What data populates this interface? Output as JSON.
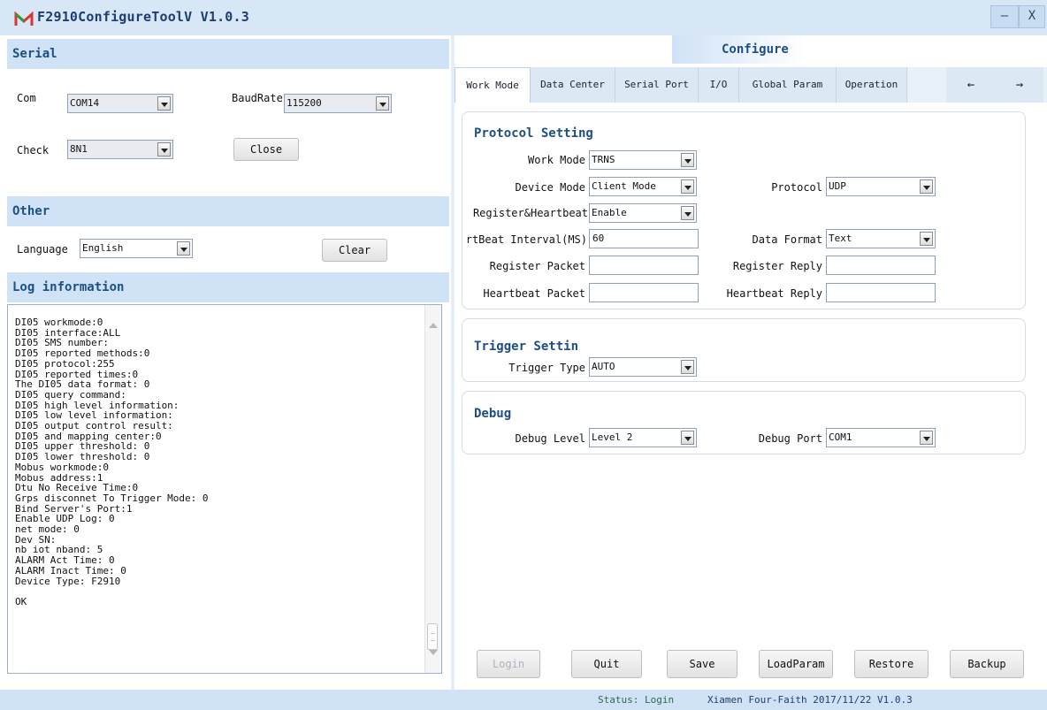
{
  "window": {
    "title": "F2910ConfigureToolV V1.0.3",
    "minimize_label": "–",
    "close_label": "X"
  },
  "serial": {
    "header": "Serial",
    "com_label": "Com",
    "com_value": "COM14",
    "baud_label": "BaudRate",
    "baud_value": "115200",
    "check_label": "Check",
    "check_value": "8N1",
    "close_button": "Close"
  },
  "other": {
    "header": "Other",
    "language_label": "Language",
    "language_value": "English",
    "clear_button": "Clear"
  },
  "log": {
    "header": "Log information",
    "lines": [
      "DI05 workmode:0",
      "DI05 interface:ALL",
      "DI05 SMS number:",
      "DI05 reported methods:0",
      "DI05 protocol:255",
      "DI05 reported times:0",
      "The DI05 data format: 0",
      "DI05 query command:",
      "DI05 high level information:",
      "DI05 low level information:",
      "DI05 output control result:",
      "DI05 and mapping center:0",
      "DI05 upper threshold: 0",
      "DI05 lower threshold: 0",
      "Mobus workmode:0",
      "Mobus address:1",
      "Dtu No Receive Time:0",
      "Grps disconnet To Trigger Mode: 0",
      "Bind Server's Port:1",
      "Enable UDP Log: 0",
      "net mode: 0",
      "Dev SN:",
      "nb iot nband: 5",
      "ALARM Act Time: 0",
      "ALARM Inact Time: 0",
      "Device Type: F2910",
      "",
      "OK"
    ]
  },
  "configure": {
    "header": "Configure",
    "tabs": [
      "Work Mode",
      "Data Center",
      "Serial Port",
      "I/O",
      "Global Param",
      "Operation"
    ],
    "active_tab": "Work Mode",
    "prev_arrow": "←",
    "next_arrow": "→",
    "protocol_setting": {
      "title": "Protocol Setting",
      "work_mode_label": "Work Mode",
      "work_mode_value": "TRNS",
      "device_mode_label": "Device Mode",
      "device_mode_value": "Client Mode",
      "protocol_label": "Protocol",
      "protocol_value": "UDP",
      "reg_hb_label": "Register&Heartbeat",
      "reg_hb_value": "Enable",
      "hb_interval_label": "rtBeat Interval(MS)",
      "hb_interval_value": "60",
      "data_format_label": "Data Format",
      "data_format_value": "Text",
      "register_packet_label": "Register Packet",
      "register_packet_value": "",
      "register_reply_label": "Register Reply",
      "register_reply_value": "",
      "heartbeat_packet_label": "Heartbeat Packet",
      "heartbeat_packet_value": "",
      "heartbeat_reply_label": "Heartbeat Reply",
      "heartbeat_reply_value": ""
    },
    "trigger_setting": {
      "title": "Trigger Settin",
      "trigger_type_label": "Trigger Type",
      "trigger_type_value": "AUTO"
    },
    "debug": {
      "title": "Debug",
      "debug_level_label": "Debug Level",
      "debug_level_value": "Level 2",
      "debug_port_label": "Debug Port",
      "debug_port_value": "COM1"
    },
    "buttons": {
      "login": "Login",
      "quit": "Quit",
      "save": "Save",
      "load_param": "LoadParam",
      "restore": "Restore",
      "backup": "Backup"
    }
  },
  "footer": {
    "status": "Status: Login",
    "vendor": "Xiamen Four-Faith 2017/11/22 V1.0.3"
  },
  "colors": {
    "header_band": "#cfe2f6",
    "title_text": "#1d4f86",
    "status_text": "#2c6b4a"
  }
}
